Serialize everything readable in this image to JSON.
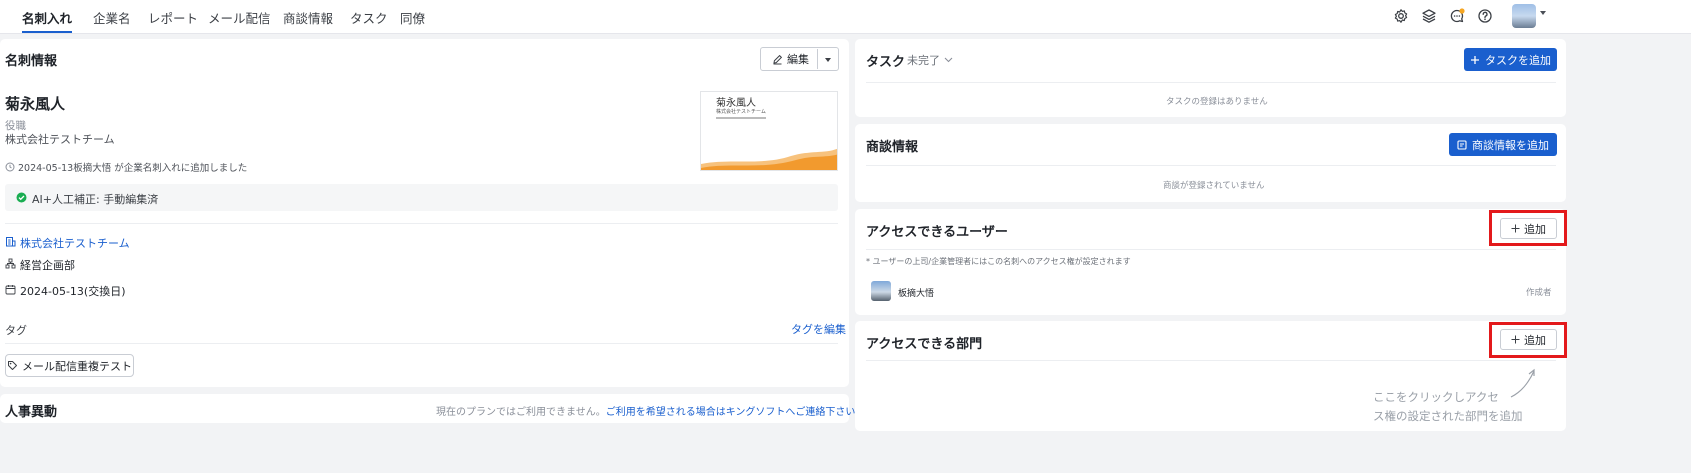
{
  "nav": {
    "tabs": [
      "名刺入れ",
      "企業名",
      "レポート",
      "メール配信",
      "商談情報",
      "タスク",
      "同僚"
    ],
    "active": "名刺入れ",
    "icons": [
      "gear-icon",
      "layers-icon",
      "chat-icon",
      "help-icon"
    ],
    "notification_color": "#f5a623"
  },
  "card_info": {
    "title": "名刺情報",
    "edit_label": "編集",
    "name": "菊永風人",
    "position": "役職",
    "company": "株式会社テストチーム",
    "history": "2024-05-13板摘大悟 が企業名刺入れに追加しました",
    "ai_status": "AI+人工補正: 手動編集済",
    "company_link": "株式会社テストチーム",
    "department": "経営企画部",
    "exchange_date": "2024-05-13(交換日)",
    "tag_label": "タグ",
    "edit_tag_label": "タグを編集",
    "tag": "メール配信重複テスト",
    "thumb_name": "菊永風人",
    "thumb_company": "株式会社テストチーム"
  },
  "personnel": {
    "title": "人事異動",
    "notice": "現在のプランではご利用できません。",
    "notice_link": "ご利用を希望される場合はキングソフトへご連絡下さい。"
  },
  "task": {
    "title": "タスク",
    "filter": "未完了",
    "add_label": "タスクを追加",
    "empty": "タスクの登録はありません"
  },
  "deal": {
    "title": "商談情報",
    "add_label": "商談情報を追加",
    "empty": "商談が登録されていません"
  },
  "access_users": {
    "title": "アクセスできるユーザー",
    "add_label": "追加",
    "note": "* ユーザーの上司/企業管理者にはこの名刺へのアクセス権が設定されます",
    "user_name": "板摘大悟",
    "user_role": "作成者"
  },
  "access_depts": {
    "title": "アクセスできる部門",
    "add_label": "追加"
  },
  "annotation": {
    "line1": "ここをクリックしアクセ",
    "line2": "ス権の設定された部門を追加",
    "color": "#e3191b"
  },
  "colors": {
    "primary": "#1a5fce",
    "success": "#1aad52",
    "thumb_wave": "#f29a2e"
  }
}
